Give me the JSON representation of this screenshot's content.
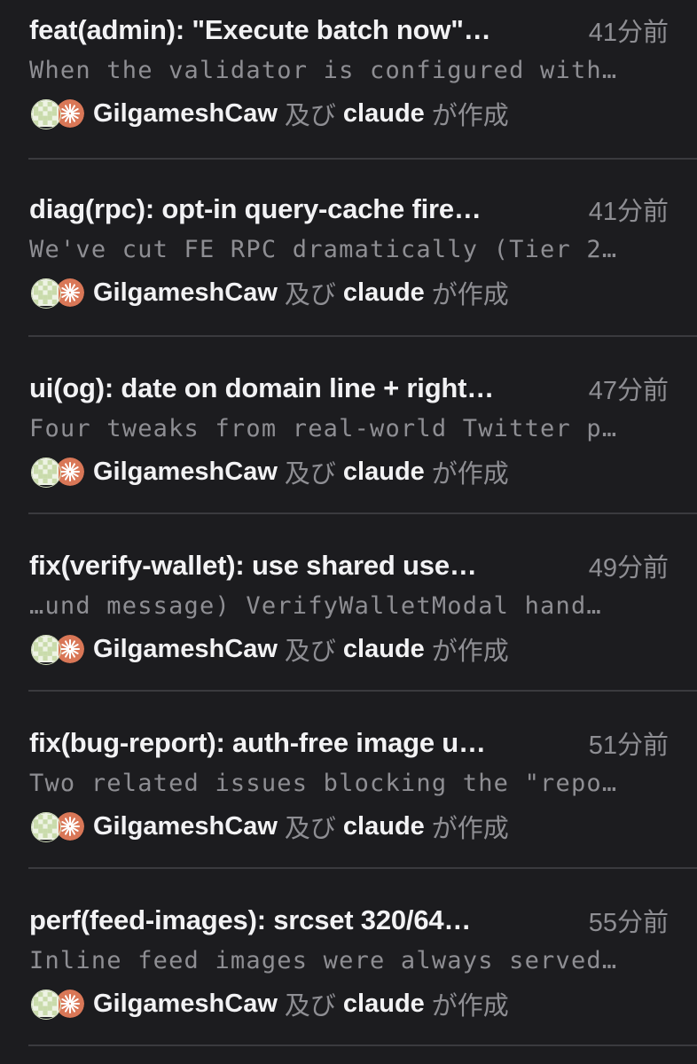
{
  "colors": {
    "background": "#1c1c1f",
    "title": "#f2f2f4",
    "secondary": "#8e8e93",
    "divider": "#3a3a3e",
    "avatar_gilgamesh": "#c9dbab",
    "avatar_claude": "#d97757"
  },
  "icons": {
    "author_avatar": "gilgamesh-avatar-icon",
    "coauthor_avatar": "claude-avatar-icon"
  },
  "commits": [
    {
      "title": "feat(admin): \"Execute batch now\"…",
      "time": "41分前",
      "body": "When the validator is configured with…",
      "author": "GilgameshCaw",
      "conjunction": "及び",
      "coauthor": "claude",
      "suffix": "が作成"
    },
    {
      "title": "diag(rpc): opt-in query-cache fire…",
      "time": "41分前",
      "body": "We've cut FE RPC dramatically (Tier 2…",
      "author": "GilgameshCaw",
      "conjunction": "及び",
      "coauthor": "claude",
      "suffix": "が作成"
    },
    {
      "title": "ui(og): date on domain line + right…",
      "time": "47分前",
      "body": "Four tweaks from real-world Twitter p…",
      "author": "GilgameshCaw",
      "conjunction": "及び",
      "coauthor": "claude",
      "suffix": "が作成"
    },
    {
      "title": "fix(verify-wallet): use shared use…",
      "time": "49分前",
      "body": "…und message)  VerifyWalletModal hand…",
      "author": "GilgameshCaw",
      "conjunction": "及び",
      "coauthor": "claude",
      "suffix": "が作成"
    },
    {
      "title": "fix(bug-report): auth-free image u…",
      "time": "51分前",
      "body": "Two related issues blocking the \"repo…",
      "author": "GilgameshCaw",
      "conjunction": "及び",
      "coauthor": "claude",
      "suffix": "が作成"
    },
    {
      "title": "perf(feed-images): srcset 320/64…",
      "time": "55分前",
      "body": "Inline feed images were always served…",
      "author": "GilgameshCaw",
      "conjunction": "及び",
      "coauthor": "claude",
      "suffix": "が作成"
    }
  ]
}
